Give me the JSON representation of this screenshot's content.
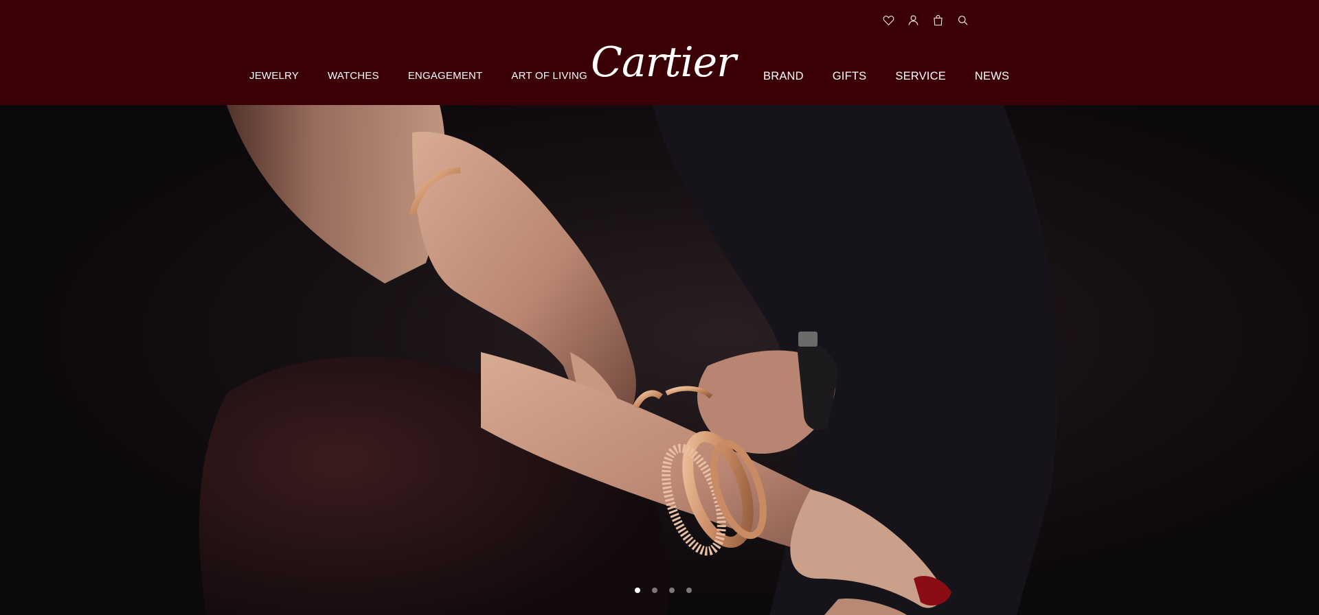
{
  "brand": {
    "logo_text": "Cartier",
    "header_color": "#3b0005"
  },
  "utility_icons": [
    {
      "name": "wishlist",
      "icon": "heart-icon"
    },
    {
      "name": "account",
      "icon": "user-icon"
    },
    {
      "name": "bag",
      "icon": "shopping-bag-icon"
    },
    {
      "name": "search",
      "icon": "search-icon"
    }
  ],
  "nav": {
    "left": [
      {
        "label": "JEWELRY"
      },
      {
        "label": "WATCHES"
      },
      {
        "label": "ENGAGEMENT"
      },
      {
        "label": "ART OF LIVING"
      }
    ],
    "right": [
      {
        "label": "BRAND"
      },
      {
        "label": "GIFTS"
      },
      {
        "label": "SERVICE"
      },
      {
        "label": "NEWS"
      }
    ]
  },
  "hero": {
    "image_subject": "hands fastening rose-gold bracelets",
    "slide_count": 4,
    "active_slide": 1
  }
}
